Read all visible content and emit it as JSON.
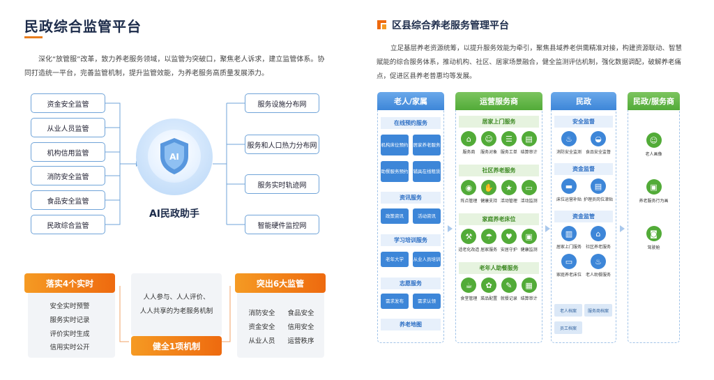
{
  "left": {
    "title": "民政综合监管平台",
    "desc": "深化“放管服”改革，致力养老服务领域，以监管为突破口，聚焦老人诉求，建立监管体系。协同打造统一平台，完善监管机制，提升监管效能，为养老服务高质量发展添力。",
    "left_items": [
      "资金安全监管",
      "从业人员监管",
      "机构信用监管",
      "消防安全监管",
      "食品安全监管",
      "民政综合监管"
    ],
    "right_items": [
      "服务设施分布网",
      "服务和人口热力分布网",
      "服务实时轨迹网",
      "智能硬件监控网"
    ],
    "ai_label": "AI民政助手",
    "ai_glyph": "AI",
    "block1": {
      "title": "落实4个实时",
      "items": [
        "安全实时预警",
        "服务实时记录",
        "评价实时生成",
        "信用实时公开"
      ]
    },
    "block2": {
      "lines": [
        "人人参与、人人评价、",
        "人人共享的为老服务机制"
      ],
      "title": "健全1项机制"
    },
    "block3": {
      "title": "突出6大监管",
      "items": [
        [
          "消防安全",
          "食品安全"
        ],
        [
          "资金安全",
          "信用安全"
        ],
        [
          "从业人员",
          "运营秩序"
        ]
      ]
    }
  },
  "right": {
    "title": "区县综合养老服务管理平台",
    "desc": "立足基层养老资源统筹，以提升服务效能为牵引，聚焦县域养老供需精准对接，构建资源联动、智慧赋能的综合服务体系，推动机构、社区、居家场景融合，健全监测评估机制，强化数据调配，破解养老痛点，促进区县养老普惠均等发展。",
    "col1": {
      "header": "老人/家属",
      "sections": [
        {
          "title": "在线预约服务",
          "buttons": [
            "机构床位预约",
            "居家养老服务",
            "助餐服务预约",
            "辅具在线租赁"
          ]
        },
        {
          "title": "资讯服务",
          "buttons": [
            "政策资讯",
            "活动资讯"
          ]
        },
        {
          "title": "学习培训服务",
          "buttons": [
            "老年大学",
            "从业人员培训"
          ]
        },
        {
          "title": "志愿服务",
          "buttons": [
            "需求发布",
            "需求认领"
          ]
        },
        {
          "title": "养老地图",
          "buttons": []
        }
      ]
    },
    "col2": {
      "header": "运营服务商",
      "sections": [
        {
          "title": "居家上门服务",
          "icons": [
            {
              "icon": "basket-icon",
              "label": "服务商"
            },
            {
              "icon": "person-icon",
              "label": "服务对象"
            },
            {
              "icon": "list-icon",
              "label": "服务工单"
            },
            {
              "icon": "receipt-icon",
              "label": "结算审计"
            }
          ]
        },
        {
          "title": "社区养老服务",
          "icons": [
            {
              "icon": "location-icon",
              "label": "阵点管理"
            },
            {
              "icon": "hand-icon",
              "label": "健康支持"
            },
            {
              "icon": "star-icon",
              "label": "活动管理"
            },
            {
              "icon": "monitor-icon",
              "label": "活动监测"
            }
          ]
        },
        {
          "title": "家庭养老床位",
          "icons": [
            {
              "icon": "tools-icon",
              "label": "适老化改造"
            },
            {
              "icon": "umbrella-icon",
              "label": "居家服务"
            },
            {
              "icon": "heart-icon",
              "label": "安居守护"
            },
            {
              "icon": "screen-icon",
              "label": "健康监测"
            }
          ]
        },
        {
          "title": "老年人助餐服务",
          "icons": [
            {
              "icon": "cup-icon",
              "label": "食堂管理"
            },
            {
              "icon": "flower-icon",
              "label": "菜品配置"
            },
            {
              "icon": "record-icon",
              "label": "就餐记录"
            },
            {
              "icon": "invoice-icon",
              "label": "结算审计"
            }
          ]
        }
      ]
    },
    "col3": {
      "header": "民政",
      "sections": [
        {
          "title": "安全监督",
          "icons": [
            {
              "icon": "extinguisher-icon",
              "label": "消防安全监测"
            },
            {
              "icon": "dish-icon",
              "label": "食品安全监督"
            }
          ]
        },
        {
          "title": "资金监督",
          "icons": [
            {
              "icon": "bed-icon",
              "label": "床位运营补贴"
            },
            {
              "icon": "wallet-icon",
              "label": "护理员岗位津贴"
            }
          ]
        },
        {
          "title": "资金监管",
          "icons": [
            {
              "icon": "building-icon",
              "label": "居家上门服务"
            },
            {
              "icon": "home-icon",
              "label": "社区养老服务"
            },
            {
              "icon": "sofa-icon",
              "label": "家庭养老床位"
            },
            {
              "icon": "meal-icon",
              "label": "老人助餐服务"
            }
          ]
        }
      ],
      "buttons": [
        "老人档案",
        "服务商档案",
        "员工档案"
      ]
    },
    "col4": {
      "header": "民政/服务商",
      "items": [
        {
          "icon": "elder-icon",
          "label": "老人画像"
        },
        {
          "icon": "id-card-icon",
          "label": "养老服务行为画"
        },
        {
          "icon": "cockpit-icon",
          "label": "驾驶舱"
        }
      ]
    }
  },
  "colors": {
    "accent_blue": "#3d86d8",
    "accent_green": "#52ab38",
    "accent_orange": "#ee6a0f",
    "title_dark": "#1c2b4a"
  }
}
